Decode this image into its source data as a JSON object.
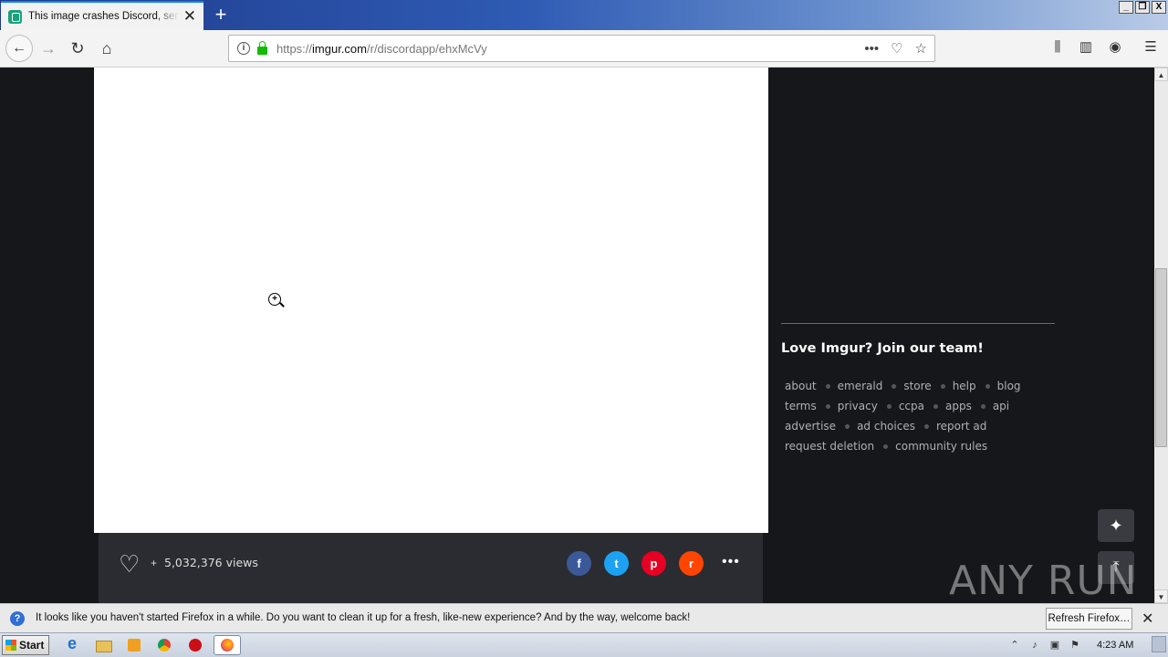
{
  "browser": {
    "tab_title": "This image crashes Discord, send it",
    "new_tab": "+",
    "url_domain": "https://imgur.com",
    "url_host": "imgur.com",
    "url_prefix": "https://",
    "url_path": "/r/discordapp/ehxMcVy",
    "window_controls": [
      "_",
      "❐",
      "X"
    ]
  },
  "post": {
    "plus": "+",
    "views": "5,032,376 views",
    "share": {
      "facebook": "f",
      "twitter": "t",
      "pinterest": "p",
      "reddit": "r",
      "more": "•••"
    }
  },
  "sidebar": {
    "join_text": "Love Imgur? Join our team!",
    "link_rows": [
      [
        "about",
        "emerald",
        "store",
        "help",
        "blog"
      ],
      [
        "terms",
        "privacy",
        "ccpa",
        "apps",
        "api"
      ],
      [
        "advertise",
        "ad choices",
        "report ad"
      ],
      [
        "request deletion",
        "community rules"
      ]
    ]
  },
  "watermark": "ANY RUN",
  "notification": {
    "message": "It looks like you haven't started Firefox in a while. Do you want to clean it up for a fresh, like-new experience? And by the way, welcome back!",
    "refresh_label": "Refresh Firefox…"
  },
  "taskbar": {
    "start_label": "Start",
    "clock": "4:23 AM"
  }
}
